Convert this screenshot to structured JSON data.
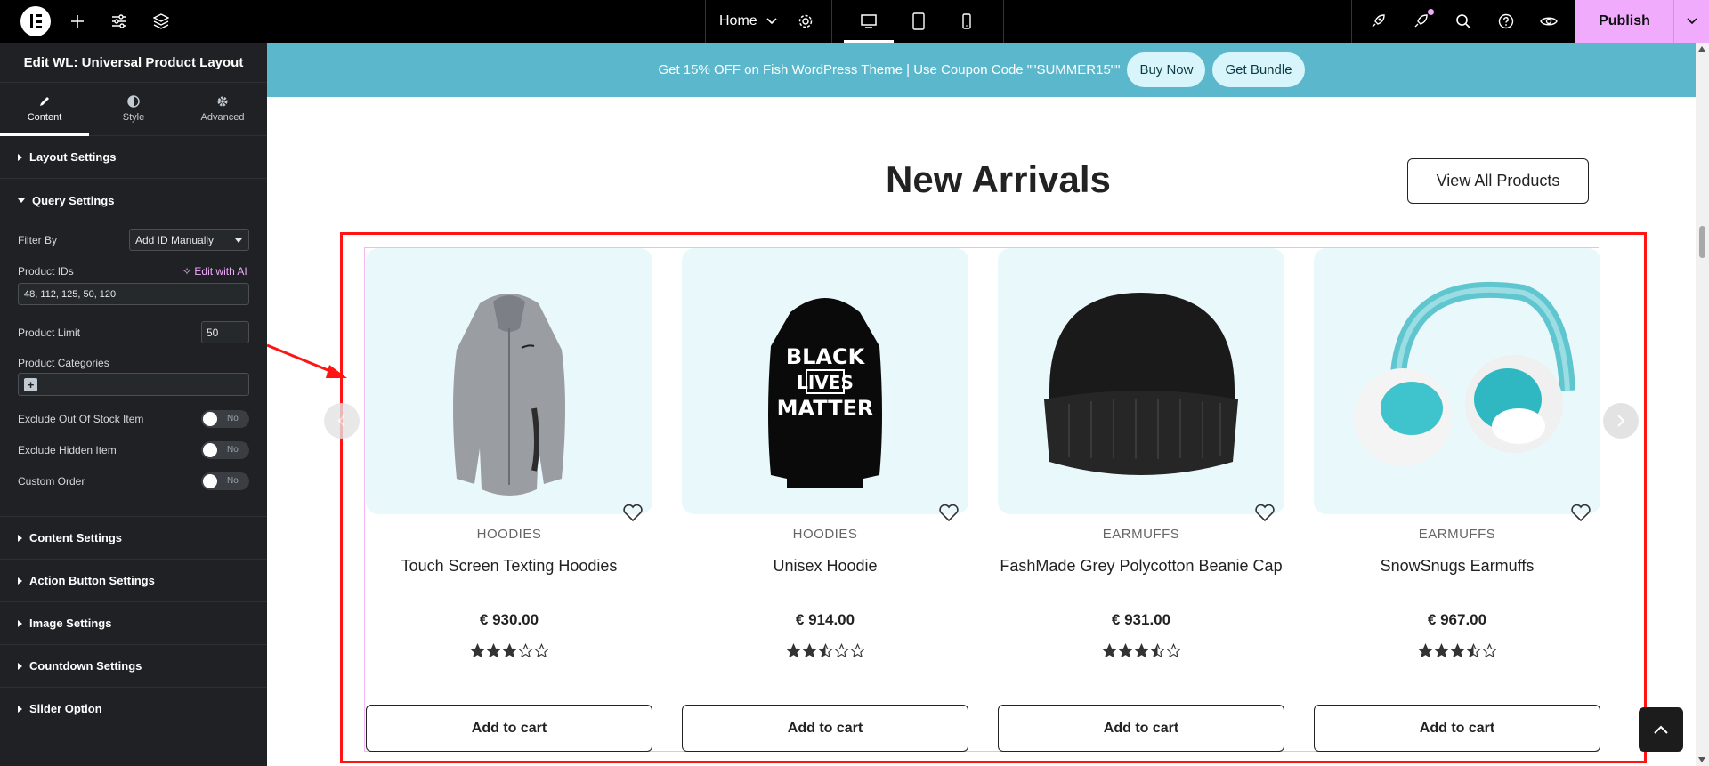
{
  "topbar": {
    "page_name": "Home",
    "publish_label": "Publish",
    "accent_color": "#f0abfc"
  },
  "panel": {
    "title": "Edit WL: Universal Product Layout",
    "tabs": [
      {
        "label": "Content",
        "icon": "pencil-icon",
        "active": true
      },
      {
        "label": "Style",
        "icon": "half-circle-icon",
        "active": false
      },
      {
        "label": "Advanced",
        "icon": "gear-icon",
        "active": false
      }
    ],
    "sections": {
      "layout": "Layout Settings",
      "query": "Query Settings",
      "content": "Content Settings",
      "action": "Action Button Settings",
      "image": "Image Settings",
      "countdown": "Countdown Settings",
      "slider": "Slider Option"
    },
    "query": {
      "filter_by_label": "Filter By",
      "filter_by_value": "Add ID Manually",
      "product_ids_label": "Product IDs",
      "edit_ai_label": "Edit with AI",
      "product_ids_value": "48, 112, 125, 50, 120",
      "product_limit_label": "Product Limit",
      "product_limit_value": "50",
      "product_categories_label": "Product Categories",
      "exclude_out_of_stock_label": "Exclude Out Of Stock Item",
      "exclude_hidden_label": "Exclude Hidden Item",
      "custom_order_label": "Custom Order",
      "toggle_off_text": "No"
    }
  },
  "canvas": {
    "promo": {
      "text": "Get 15% OFF on Fish WordPress Theme | Use Coupon Code \"\"SUMMER15\"\"",
      "buy_now": "Buy Now",
      "get_bundle": "Get Bundle",
      "bg_color": "#5bb7cc"
    },
    "heading": "New Arrivals",
    "view_all": "View All Products",
    "products": [
      {
        "category": "HOODIES",
        "title": "Touch Screen Texting Hoodies",
        "price": "€ 930.00",
        "rating": 3,
        "cart": "Add to cart",
        "image": "grey-jacket"
      },
      {
        "category": "HOODIES",
        "title": "Unisex Hoodie",
        "price": "€ 914.00",
        "rating": 2.5,
        "cart": "Add to cart",
        "image": "black-hoodie",
        "hoodie_text": [
          "BLACK",
          "LIVES",
          "MATTER"
        ]
      },
      {
        "category": "EARMUFFS",
        "title": "FashMade Grey Polycotton Beanie Cap",
        "price": "€ 931.00",
        "rating": 3.5,
        "cart": "Add to cart",
        "image": "black-beanie"
      },
      {
        "category": "EARMUFFS",
        "title": "SnowSnugs Earmuffs",
        "price": "€ 967.00",
        "rating": 3.5,
        "cart": "Add to cart",
        "image": "teal-earmuffs"
      }
    ]
  }
}
